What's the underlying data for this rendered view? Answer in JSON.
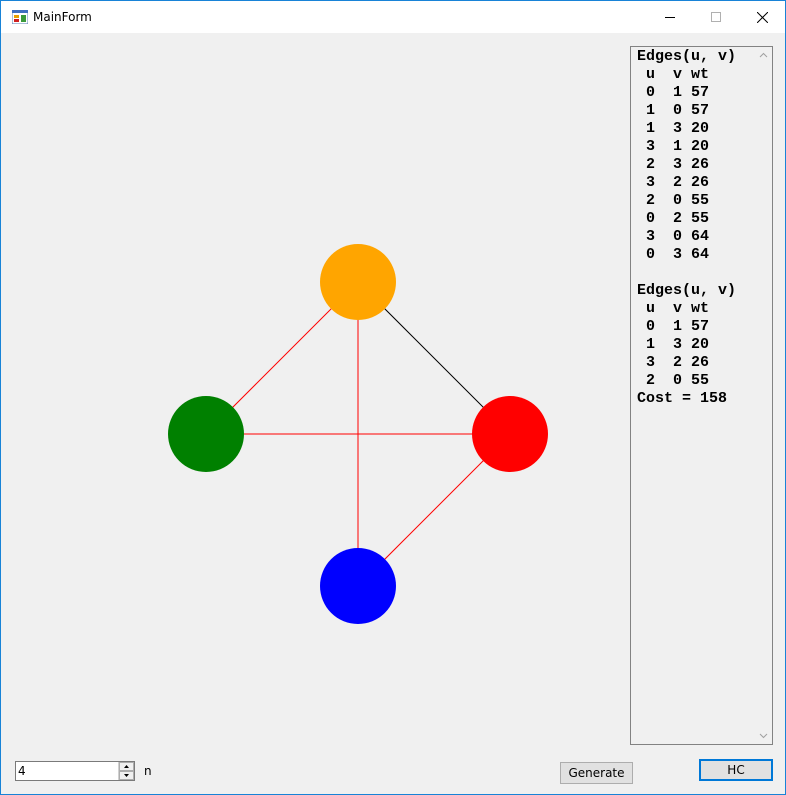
{
  "window": {
    "title": "MainForm",
    "icon": "winforms-app-icon",
    "controls": {
      "minimize": "minimize-icon",
      "maximize": "maximize-icon",
      "close": "close-icon"
    }
  },
  "graph": {
    "nodes": [
      {
        "id": 0,
        "color": "#ffa500"
      },
      {
        "id": 1,
        "color": "#008000"
      },
      {
        "id": 2,
        "color": "#ff0000"
      },
      {
        "id": 3,
        "color": "#0000ff"
      }
    ],
    "edges": [
      {
        "u": 0,
        "v": 1,
        "color": "#ff0000"
      },
      {
        "u": 0,
        "v": 3,
        "color": "#ff0000"
      },
      {
        "u": 0,
        "v": 2,
        "color": "#000000"
      },
      {
        "u": 1,
        "v": 2,
        "color": "#ff0000"
      },
      {
        "u": 2,
        "v": 3,
        "color": "#ff0000"
      }
    ]
  },
  "output": {
    "text": "Edges(u, v)\n u  v wt\n 0  1 57\n 1  0 57\n 1  3 20\n 3  1 20\n 2  3 26\n 3  2 26\n 2  0 55\n 0  2 55\n 3  0 64\n 0  3 64\n\nEdges(u, v)\n u  v wt\n 0  1 57\n 1  3 20\n 3  2 26\n 2  0 55\nCost = 158"
  },
  "controls": {
    "n_value": "4",
    "n_label": "n",
    "generate_label": "Generate",
    "hc_label": "HC"
  }
}
